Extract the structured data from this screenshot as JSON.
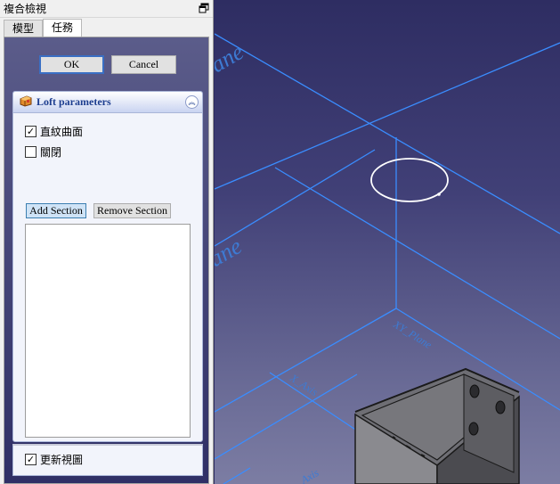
{
  "combo_view": {
    "title": "複合檢視",
    "tabs": [
      {
        "label": "模型",
        "active": false
      },
      {
        "label": "任務",
        "active": true
      }
    ]
  },
  "dialog": {
    "ok_label": "OK",
    "cancel_label": "Cancel"
  },
  "loft_panel": {
    "title": "Loft parameters",
    "ruled_surface": {
      "label": "直紋曲面",
      "checked": true
    },
    "closed": {
      "label": "關閉",
      "checked": false
    },
    "add_section_label": "Add Section",
    "remove_section_label": "Remove Section",
    "sections": []
  },
  "update_view": {
    "label": "更新視圖",
    "checked": true
  },
  "viewport": {
    "labels": {
      "top_plane": "ane",
      "mid_plane": "ane",
      "xy_plane": "XY_Plane",
      "x_axis": "X_Axis",
      "y_axis": "Axis"
    },
    "line_color": "#3a8dff",
    "circle_color": "#ffffff"
  }
}
